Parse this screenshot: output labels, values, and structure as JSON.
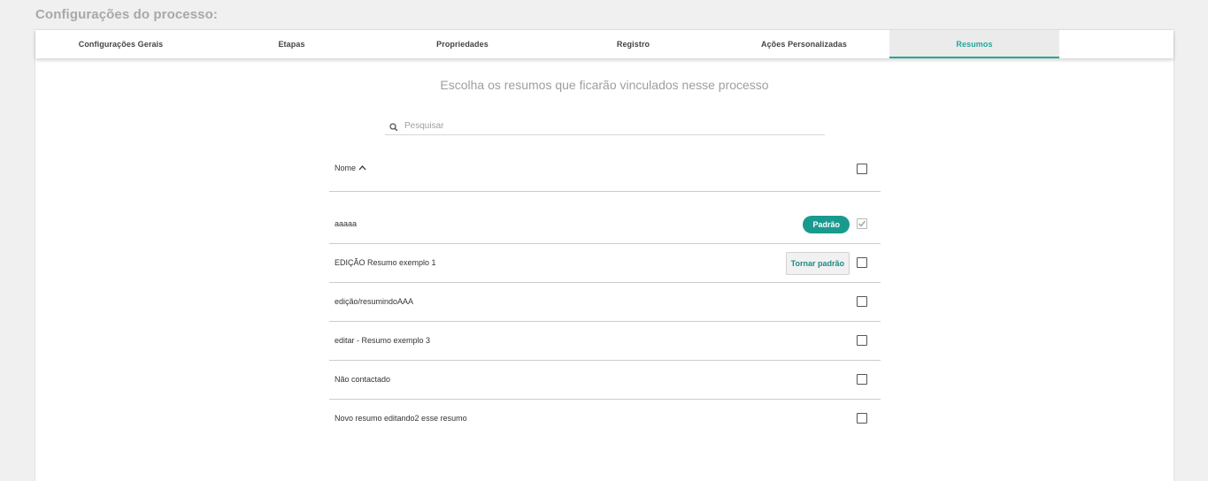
{
  "page": {
    "title": "Configurações do processo:"
  },
  "tabs": [
    {
      "label": "Configurações Gerais",
      "active": false
    },
    {
      "label": "Etapas",
      "active": false
    },
    {
      "label": "Propriedades",
      "active": false
    },
    {
      "label": "Registro",
      "active": false
    },
    {
      "label": "Ações Personalizadas",
      "active": false
    },
    {
      "label": "Resumos",
      "active": true
    }
  ],
  "main": {
    "heading": "Escolha os resumos que ficarão vinculados nesse processo",
    "search": {
      "placeholder": "Pesquisar",
      "value": "",
      "icon": "search-icon"
    },
    "table": {
      "column_name": "Nome",
      "sort_icon": "chevron-up-icon",
      "select_all_checked": false,
      "rows": [
        {
          "name": "aaaaa",
          "badge": "Padrão",
          "checked": true
        },
        {
          "name": "EDIÇÃO Resumo exemplo 1",
          "button": "Tornar padrão",
          "checked": false
        },
        {
          "name": "edição/resumindoAAA",
          "checked": false
        },
        {
          "name": "editar - Resumo exemplo 3",
          "checked": false
        },
        {
          "name": "Não contactado",
          "checked": false
        },
        {
          "name": "Novo resumo editando2 esse resumo",
          "checked": false
        }
      ]
    }
  },
  "colors": {
    "accent": "#26a69a",
    "badge": "#1a9a8e"
  }
}
